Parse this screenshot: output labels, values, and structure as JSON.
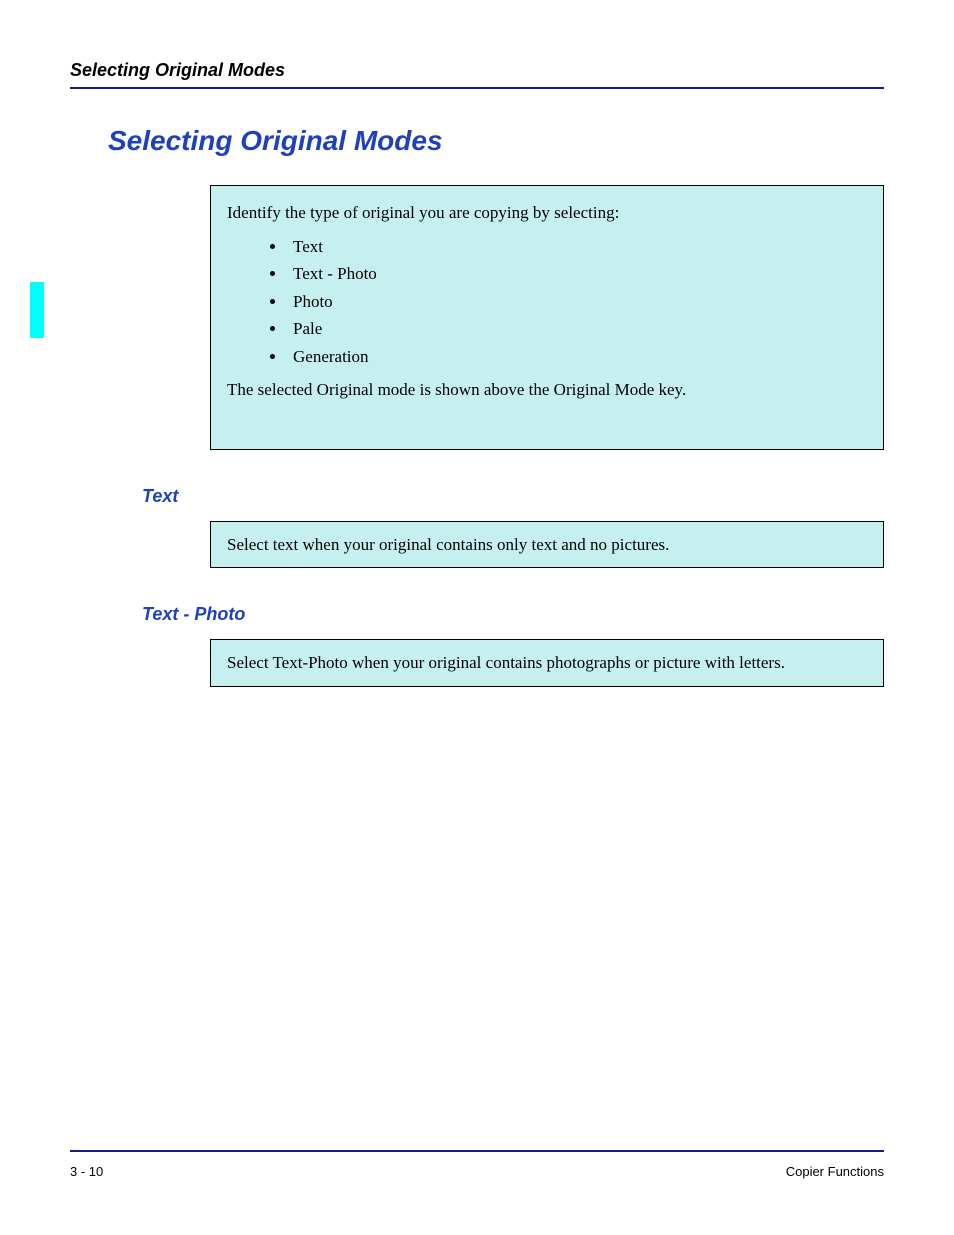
{
  "header": {
    "running": "Selecting Original Modes"
  },
  "title": "Selecting Original Modes",
  "intro_box": {
    "lead": "Identify the type of original you are copying by selecting:",
    "items": [
      "Text",
      "Text - Photo",
      "Photo",
      "Pale",
      "Generation"
    ],
    "tail": "The selected Original mode is shown above the Original Mode key."
  },
  "sections": [
    {
      "heading": "Text",
      "body": "Select text when your original contains only text and no pictures."
    },
    {
      "heading": "Text - Photo",
      "body": "Select Text-Photo when your original contains photographs or picture with letters."
    }
  ],
  "footer": {
    "left": "3 - 10",
    "right": "Copier Functions"
  }
}
